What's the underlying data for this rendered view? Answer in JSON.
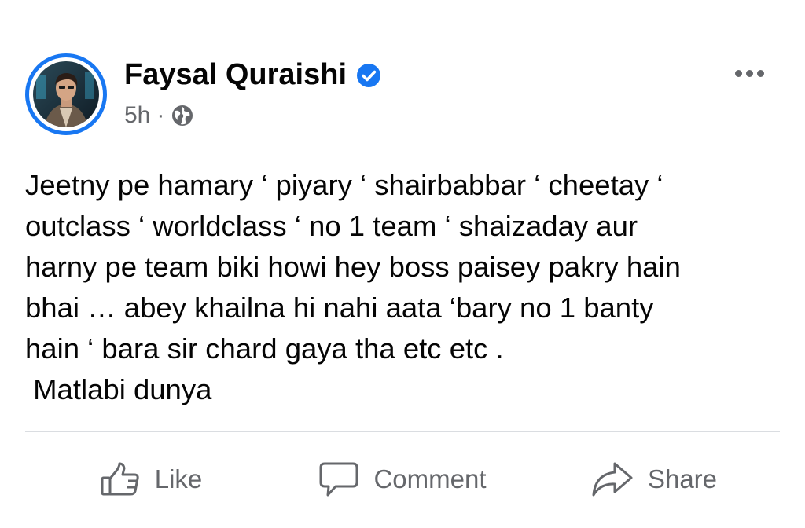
{
  "post": {
    "author": "Faysal Quraishi",
    "verified": true,
    "time": "5h",
    "separator": "·",
    "audience_icon": "globe-icon",
    "more_icon": "more-options-icon",
    "body": "Jeetny pe hamary ‘ piyary ‘ shairbabbar ‘ cheetay ‘\noutclass ‘ worldclass ‘ no 1 team ‘ shaizaday aur\nharny pe team biki howi hey boss paisey pakry hain\nbhai … abey khailna hi nahi aata ‘bary no 1 banty\nhain ‘ bara sir chard gaya tha etc etc .\n Matlabi dunya"
  },
  "actions": {
    "like_label": "Like",
    "comment_label": "Comment",
    "share_label": "Share"
  },
  "colors": {
    "brand_blue": "#1877f2",
    "secondary_text": "#65676b",
    "primary_text": "#050505",
    "divider": "#dadde1"
  }
}
